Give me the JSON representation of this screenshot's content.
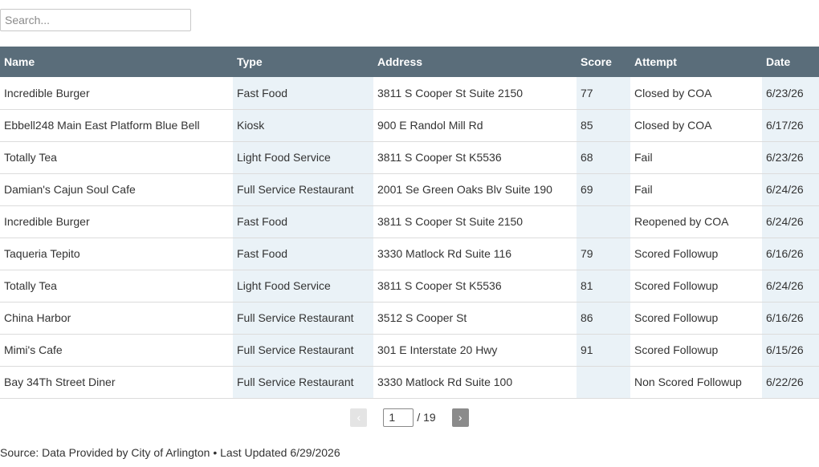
{
  "search": {
    "placeholder": "Search...",
    "value": ""
  },
  "table": {
    "columns": [
      "Name",
      "Type",
      "Address",
      "Score",
      "Attempt",
      "Date"
    ],
    "rows": [
      [
        "Incredible Burger",
        "Fast Food",
        "3811 S Cooper St Suite 2150",
        "77",
        "Closed by COA",
        "6/23/26"
      ],
      [
        "Ebbell248 Main East Platform Blue Bell",
        "Kiosk",
        "900 E Randol Mill Rd",
        "85",
        "Closed by COA",
        "6/17/26"
      ],
      [
        "Totally Tea",
        "Light Food Service",
        "3811 S Cooper St K5536",
        "68",
        "Fail",
        "6/23/26"
      ],
      [
        "Damian's Cajun Soul Cafe",
        "Full Service Restaurant",
        "2001 Se Green Oaks Blv Suite 190",
        "69",
        "Fail",
        "6/24/26"
      ],
      [
        "Incredible Burger",
        "Fast Food",
        "3811 S Cooper St Suite 2150",
        "",
        "Reopened by COA",
        "6/24/26"
      ],
      [
        "Taqueria Tepito",
        "Fast Food",
        "3330 Matlock Rd Suite 116",
        "79",
        "Scored Followup",
        "6/16/26"
      ],
      [
        "Totally Tea",
        "Light Food Service",
        "3811 S Cooper St K5536",
        "81",
        "Scored Followup",
        "6/24/26"
      ],
      [
        "China Harbor",
        "Full Service Restaurant",
        "3512 S Cooper St",
        "86",
        "Scored Followup",
        "6/16/26"
      ],
      [
        "Mimi's Cafe",
        "Full Service Restaurant",
        "301 E Interstate 20 Hwy",
        "91",
        "Scored Followup",
        "6/15/26"
      ],
      [
        "Bay 34Th Street Diner",
        "Full Service Restaurant",
        "3330 Matlock Rd Suite 100",
        "",
        "Non Scored Followup",
        "6/22/26"
      ]
    ]
  },
  "pager": {
    "prev_label": "‹",
    "next_label": "›",
    "current_page": "1",
    "total": "/ 19"
  },
  "footer": {
    "text": "Source: Data Provided by City of Arlington • Last Updated 6/29/2026"
  }
}
